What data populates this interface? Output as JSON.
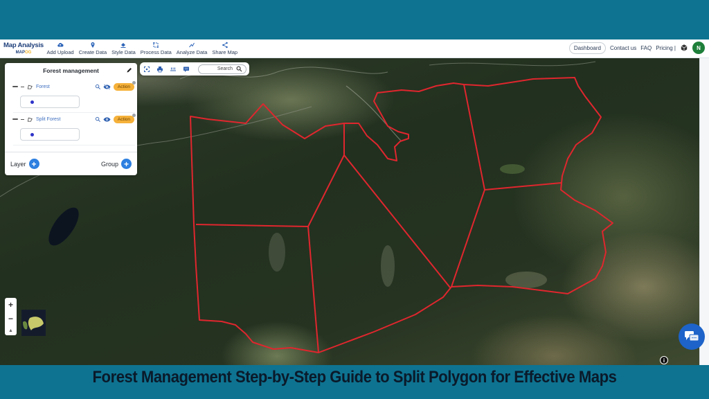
{
  "colors": {
    "banner": "#0e7391",
    "accent": "#2d7fe0",
    "action": "#f5b13a",
    "polygon_stroke": "#e0262e",
    "avatar": "#1e7f3a",
    "chat": "#1d63c9"
  },
  "header": {
    "logo_line1": "Map Analysis",
    "logo_line2_a": "MAP",
    "logo_line2_b": "OG",
    "menu": [
      {
        "label": "Add Upload",
        "icon": "cloud-upload-icon"
      },
      {
        "label": "Create Data",
        "icon": "location-pin-icon"
      },
      {
        "label": "Style Data",
        "icon": "paint-bucket-icon"
      },
      {
        "label": "Process Data",
        "icon": "process-icon"
      },
      {
        "label": "Analyze Data",
        "icon": "analyze-icon"
      },
      {
        "label": "Share Map",
        "icon": "share-icon"
      }
    ],
    "right": {
      "dashboard": "Dashboard",
      "contact": "Contact us",
      "faq": "FAQ",
      "pricing": "Pricing |",
      "avatar_initial": "N"
    }
  },
  "layer_panel": {
    "title": "Forest management",
    "layers": [
      {
        "name": "Forest",
        "visibility": "hidden",
        "action": "Action"
      },
      {
        "name": "Split Forest",
        "visibility": "visible",
        "action": "Action"
      }
    ],
    "footer": {
      "layer": "Layer",
      "group": "Group"
    }
  },
  "map_toolbar": {
    "search_label": "Search",
    "tools": [
      "fullscreen-icon",
      "print-icon",
      "measure-icon",
      "comment-icon"
    ]
  },
  "map_controls": {
    "zoom_in": "+",
    "zoom_out": "−",
    "compass": "▲",
    "info": "i"
  },
  "caption": "Forest Management Step-by-Step Guide to Split Polygon for Effective Maps"
}
